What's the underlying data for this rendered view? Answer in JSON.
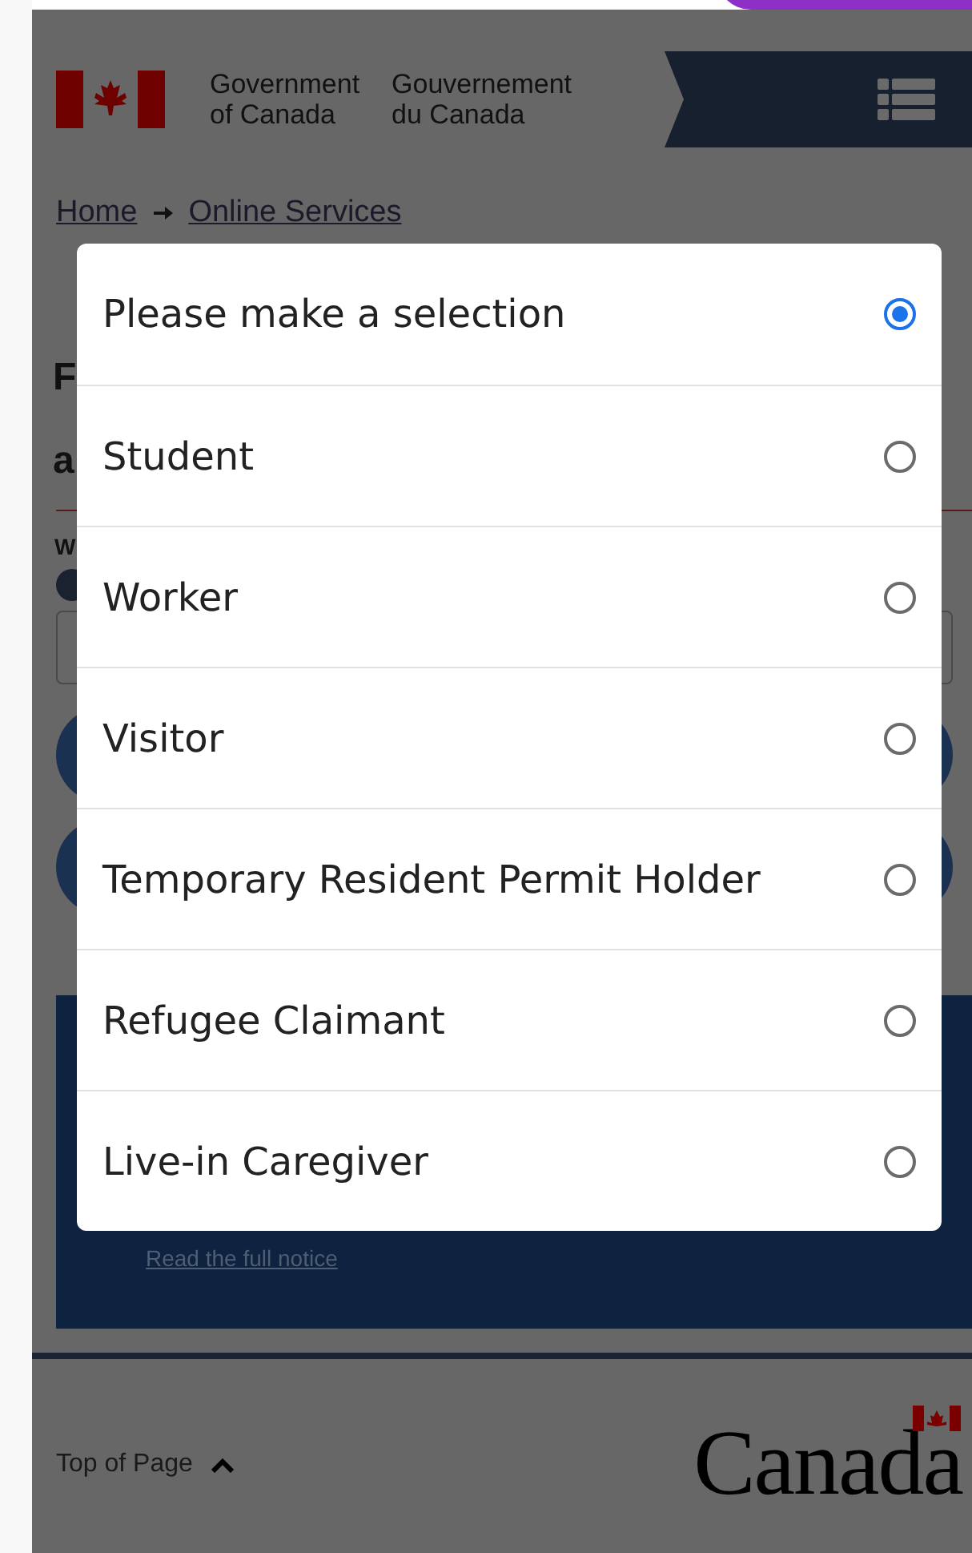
{
  "header": {
    "government_en": [
      "Government",
      "of Canada"
    ],
    "government_fr": [
      "Gouvernement",
      "du Canada"
    ]
  },
  "breadcrumb": [
    {
      "label": "Home"
    },
    {
      "label": "Online Services"
    }
  ],
  "page_fragments": {
    "heading": [
      "F",
      "a"
    ],
    "label": "W"
  },
  "notice": {
    "link": "Read the full notice"
  },
  "dialog": {
    "options": [
      {
        "label": "Please make a selection",
        "selected": true
      },
      {
        "label": "Student",
        "selected": false
      },
      {
        "label": "Worker",
        "selected": false
      },
      {
        "label": "Visitor",
        "selected": false
      },
      {
        "label": "Temporary Resident Permit Holder",
        "selected": false
      },
      {
        "label": "Refugee Claimant",
        "selected": false
      },
      {
        "label": "Live-in Caregiver",
        "selected": false
      }
    ]
  },
  "footer": {
    "top_link": "Top of Page",
    "wordmark": "Canada"
  }
}
